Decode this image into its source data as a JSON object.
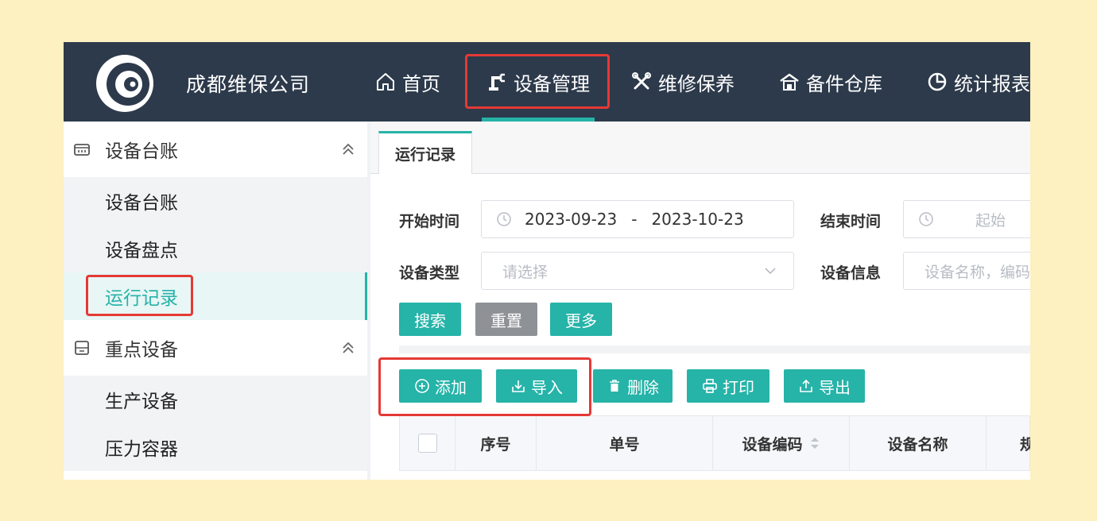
{
  "header": {
    "company": "成都维保公司",
    "nav": [
      {
        "label": "首页",
        "icon": "home-icon"
      },
      {
        "label": "设备管理",
        "icon": "robot-arm-icon",
        "active": true
      },
      {
        "label": "维修保养",
        "icon": "tools-icon"
      },
      {
        "label": "备件仓库",
        "icon": "warehouse-icon"
      },
      {
        "label": "统计报表",
        "icon": "pie-chart-icon"
      }
    ]
  },
  "sidebar": {
    "groups": [
      {
        "label": "设备台账",
        "icon": "ledger-icon",
        "items": [
          "设备台账",
          "设备盘点",
          "运行记录"
        ],
        "active_item": "运行记录"
      },
      {
        "label": "重点设备",
        "icon": "box-icon",
        "items": [
          "生产设备",
          "压力容器"
        ]
      }
    ]
  },
  "tabs": [
    {
      "label": "运行记录",
      "active": true
    }
  ],
  "filters": {
    "start_time": {
      "label": "开始时间",
      "from": "2023-09-23",
      "separator": "-",
      "to": "2023-10-23"
    },
    "end_time": {
      "label": "结束时间",
      "placeholder": "起始"
    },
    "device_type": {
      "label": "设备类型",
      "placeholder": "请选择"
    },
    "device_info": {
      "label": "设备信息",
      "placeholder": "设备名称，编码"
    }
  },
  "search_buttons": {
    "search": "搜索",
    "reset": "重置",
    "more": "更多"
  },
  "toolbar": {
    "add": "添加",
    "import": "导入",
    "delete": "删除",
    "print": "打印",
    "export": "导出"
  },
  "table": {
    "columns": [
      "序号",
      "单号",
      "设备编码",
      "设备名称",
      "规"
    ]
  },
  "colors": {
    "accent": "#26b3a8",
    "header_bg": "#2d3a4b",
    "highlight": "#e53935"
  }
}
